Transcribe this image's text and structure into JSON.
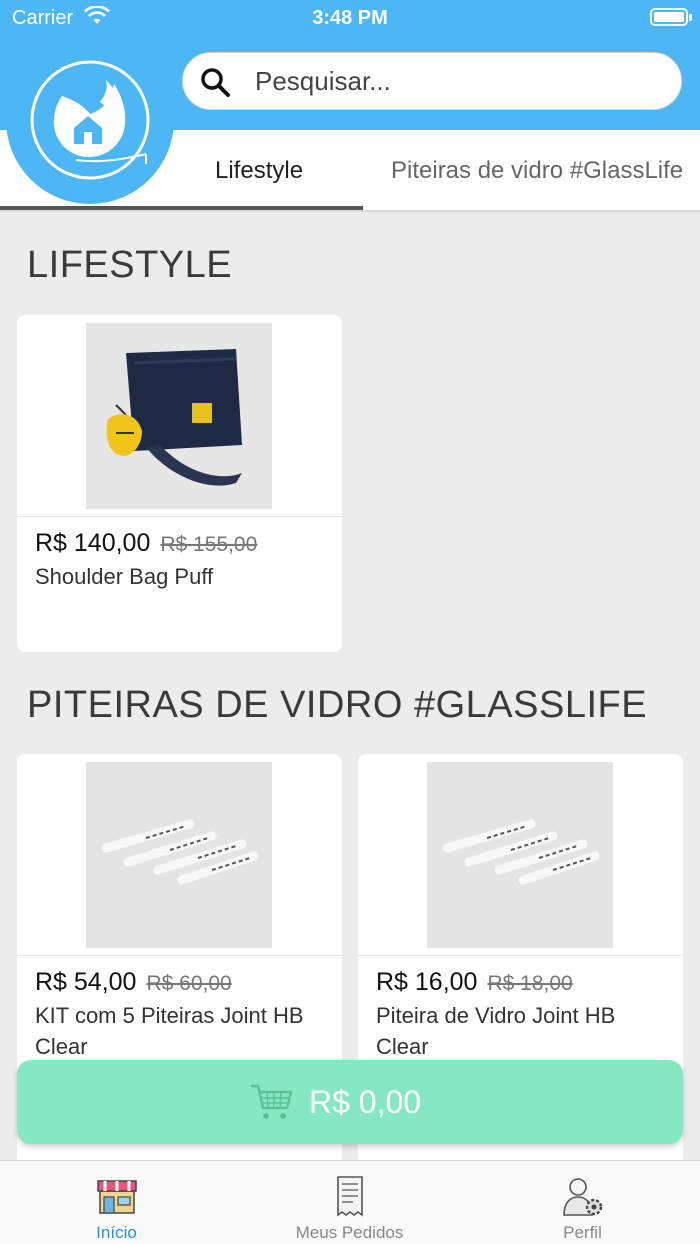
{
  "status_bar": {
    "carrier": "Carrier",
    "time": "3:48 PM"
  },
  "search": {
    "placeholder": "Pesquisar..."
  },
  "tabs": [
    {
      "label": "Lifestyle",
      "selected": true
    },
    {
      "label": "Piteiras de vidro #GlassLife",
      "selected": false
    }
  ],
  "sections": [
    {
      "title": "LIFESTYLE",
      "products": [
        {
          "price": "R$ 140,00",
          "old_price": "R$ 155,00",
          "name": "Shoulder Bag Puff",
          "image": "shoulder-bag-photo"
        }
      ]
    },
    {
      "title": "PITEIRAS DE VIDRO #GLASSLIFE",
      "products": [
        {
          "price": "R$ 54,00",
          "old_price": "R$ 60,00",
          "name": "KIT com 5 Piteiras Joint HB Clear",
          "image": "glass-tips-photo"
        },
        {
          "price": "R$ 16,00",
          "old_price": "R$ 18,00",
          "name": "Piteira de Vidro Joint HB Clear",
          "image": "glass-tips-photo"
        }
      ]
    }
  ],
  "cart": {
    "total": "R$ 0,00",
    "icon": "shopping-cart-icon"
  },
  "bottom_nav": [
    {
      "label": "Início",
      "icon": "storefront-icon",
      "active": true
    },
    {
      "label": "Meus Pedidos",
      "icon": "receipt-icon",
      "active": false
    },
    {
      "label": "Perfil",
      "icon": "user-settings-icon",
      "active": false
    }
  ],
  "colors": {
    "header": "#4db6f4",
    "cart_button": "#86e8c3",
    "active_nav": "#2a90e6"
  }
}
